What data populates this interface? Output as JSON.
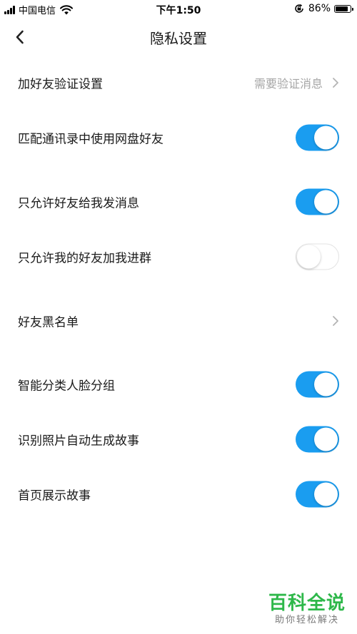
{
  "status_bar": {
    "carrier": "中国电信",
    "time": "下午1:50",
    "battery_percent": "86%",
    "battery_level": 0.86
  },
  "nav": {
    "title": "隐私设置"
  },
  "settings": {
    "friend_verification": {
      "label": "加好友验证设置",
      "value": "需要验证消息"
    },
    "match_contacts": {
      "label": "匹配通讯录中使用网盘好友",
      "enabled": true
    },
    "only_friends_message": {
      "label": "只允许好友给我发消息",
      "enabled": true
    },
    "only_friends_group": {
      "label": "只允许我的好友加我进群",
      "enabled": false
    },
    "blacklist": {
      "label": "好友黑名单"
    },
    "face_grouping": {
      "label": "智能分类人脸分组",
      "enabled": true
    },
    "photo_story": {
      "label": "识别照片自动生成故事",
      "enabled": true
    },
    "home_story": {
      "label": "首页展示故事",
      "enabled": true
    }
  },
  "watermark": {
    "title": "百科全说",
    "subtitle": "助你轻松解决"
  },
  "colors": {
    "toggle_on": "#1a9df0",
    "toggle_off_border": "#e3e3e3",
    "secondary_text": "#a6a6a6",
    "watermark_green": "#2eb84a"
  }
}
